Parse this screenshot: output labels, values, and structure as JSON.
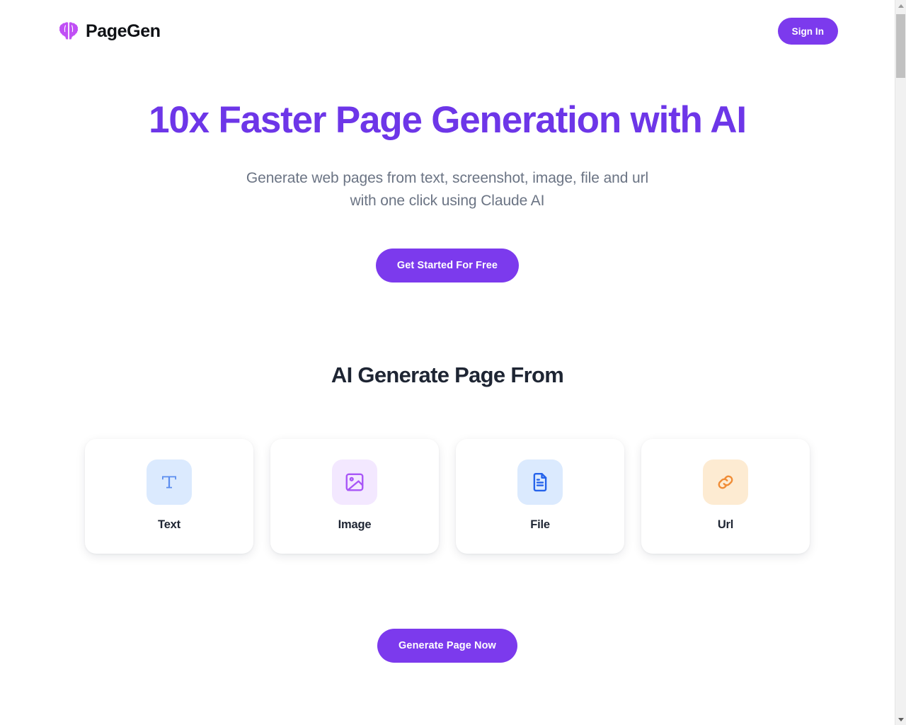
{
  "theme": {
    "brand_purple": "#7c3aed",
    "headline_purple": "#6d36e8",
    "body_gray": "#6b7484",
    "heading_dark": "#1e2533",
    "page_background": "#ffffff"
  },
  "header": {
    "logo_icon": "brain-logo-icon",
    "brand_name": "PageGen",
    "signin_label": "Sign In"
  },
  "hero": {
    "title": "10x Faster Page Generation with AI",
    "subtitle_line1": "Generate web pages from text, screenshot, image, file and url",
    "subtitle_line2": "with one click using Claude AI",
    "cta_label": "Get Started For Free"
  },
  "section": {
    "title": "AI Generate Page From",
    "cards": [
      {
        "label": "Text",
        "icon": "text-t-icon",
        "tile_color": "#dbeafe",
        "icon_color": "#5b8def"
      },
      {
        "label": "Image",
        "icon": "image-picture-icon",
        "tile_color": "#f3e8ff",
        "icon_color": "#a855f7"
      },
      {
        "label": "File",
        "icon": "file-document-icon",
        "tile_color": "#dbeafe",
        "icon_color": "#2563eb"
      },
      {
        "label": "Url",
        "icon": "link-chain-icon",
        "tile_color": "#fdebd2",
        "icon_color": "#f08c36"
      }
    ],
    "generate_label": "Generate Page Now"
  },
  "scrollbar": {
    "up_arrow": "scroll-up-arrow-icon",
    "down_arrow": "scroll-down-arrow-icon"
  }
}
